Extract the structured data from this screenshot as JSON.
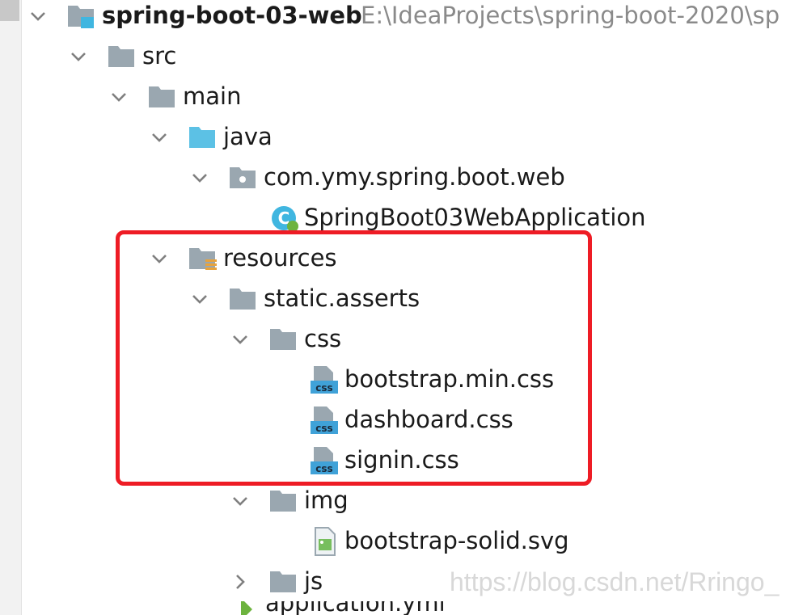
{
  "tree": [
    {
      "key": "root",
      "label": "spring-boot-03-web",
      "path": "E:\\IdeaProjects\\spring-boot-2020\\sp",
      "icon": "module-folder-icon",
      "expanded": true
    },
    {
      "key": "src",
      "label": "src",
      "icon": "folder-icon",
      "expanded": true
    },
    {
      "key": "main",
      "label": "main",
      "icon": "folder-icon",
      "expanded": true
    },
    {
      "key": "java",
      "label": "java",
      "icon": "source-folder-icon",
      "expanded": true
    },
    {
      "key": "package",
      "label": "com.ymy.spring.boot.web",
      "icon": "package-icon",
      "expanded": true
    },
    {
      "key": "app",
      "label": "SpringBoot03WebApplication",
      "icon": "spring-boot-class-icon"
    },
    {
      "key": "resources",
      "label": "resources",
      "icon": "resources-folder-icon",
      "expanded": true
    },
    {
      "key": "static",
      "label": "static.asserts",
      "icon": "folder-icon",
      "expanded": true
    },
    {
      "key": "css",
      "label": "css",
      "icon": "folder-icon",
      "expanded": true
    },
    {
      "key": "bootstrap",
      "label": "bootstrap.min.css",
      "icon": "css-file-icon"
    },
    {
      "key": "dashboard",
      "label": "dashboard.css",
      "icon": "css-file-icon"
    },
    {
      "key": "signin",
      "label": "signin.css",
      "icon": "css-file-icon"
    },
    {
      "key": "img",
      "label": "img",
      "icon": "folder-icon",
      "expanded": true
    },
    {
      "key": "svgfile",
      "label": "bootstrap-solid.svg",
      "icon": "image-file-icon"
    },
    {
      "key": "js",
      "label": "js",
      "icon": "folder-icon",
      "expanded": false
    },
    {
      "key": "appprops",
      "label": "application.yml",
      "icon": "yaml-file-icon"
    }
  ],
  "watermark": "https://blog.csdn.net/Rringo_",
  "colors": {
    "highlight": "#ee1c25",
    "folder": "#9aa7b0",
    "source_folder": "#40b6e0",
    "css_badge": "#40a2d8",
    "chevron": "#7f7f7f"
  }
}
